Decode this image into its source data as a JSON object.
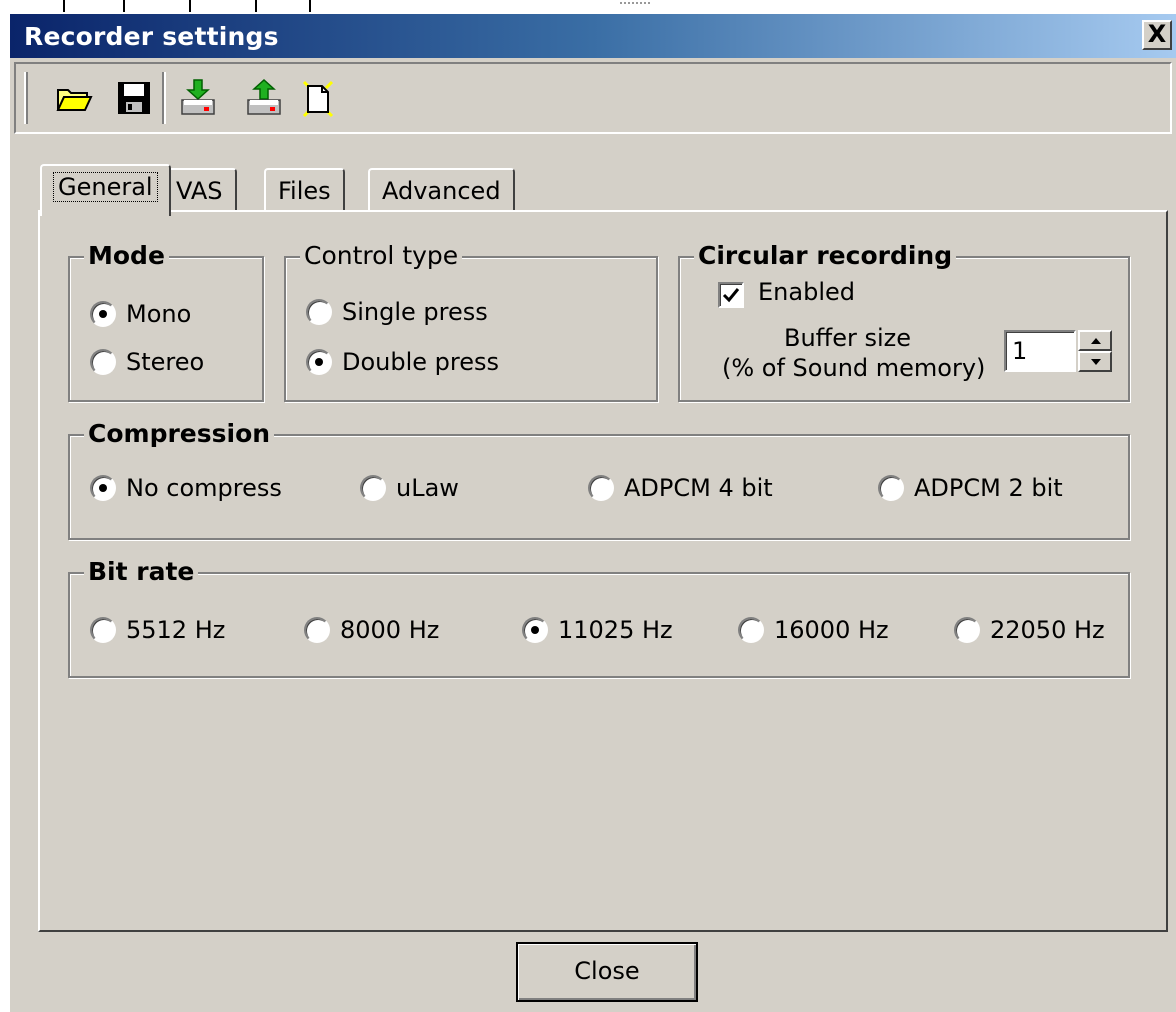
{
  "window": {
    "title": "Recorder settings",
    "close_glyph": "X",
    "colors": {
      "title_start": "#0a246a",
      "title_end": "#a6caf0",
      "face": "#d4d0c8"
    }
  },
  "toolbar": {
    "buttons": [
      {
        "icon": "open-folder-icon"
      },
      {
        "icon": "save-floppy-icon"
      },
      {
        "icon": "upload-to-device-icon"
      },
      {
        "icon": "download-from-device-icon"
      },
      {
        "icon": "new-default-icon"
      }
    ]
  },
  "tabs": [
    {
      "label": "General",
      "active": true
    },
    {
      "label": "VAS",
      "active": false
    },
    {
      "label": "Files",
      "active": false
    },
    {
      "label": "Advanced",
      "active": false
    }
  ],
  "mode": {
    "title": "Mode",
    "options": [
      {
        "label": "Mono",
        "checked": true
      },
      {
        "label": "Stereo",
        "checked": false
      }
    ]
  },
  "control_type": {
    "title": "Control type",
    "options": [
      {
        "label": "Single press",
        "checked": false
      },
      {
        "label": "Double press",
        "checked": true
      }
    ]
  },
  "circular": {
    "title": "Circular recording",
    "enabled_label": "Enabled",
    "enabled": true,
    "buffer_label_line1": "Buffer size",
    "buffer_label_line2": "(% of Sound memory)",
    "buffer_value": "1"
  },
  "compression": {
    "title": "Compression",
    "options": [
      {
        "label": "No compress",
        "checked": true
      },
      {
        "label": "uLaw",
        "checked": false
      },
      {
        "label": "ADPCM 4 bit",
        "checked": false
      },
      {
        "label": "ADPCM 2 bit",
        "checked": false
      }
    ]
  },
  "bitrate": {
    "title": "Bit rate",
    "options": [
      {
        "label": "5512 Hz",
        "checked": false
      },
      {
        "label": "8000 Hz",
        "checked": false
      },
      {
        "label": "11025 Hz",
        "checked": true
      },
      {
        "label": "16000 Hz",
        "checked": false
      },
      {
        "label": "22050 Hz",
        "checked": false
      }
    ]
  },
  "footer": {
    "close_label": "Close"
  }
}
